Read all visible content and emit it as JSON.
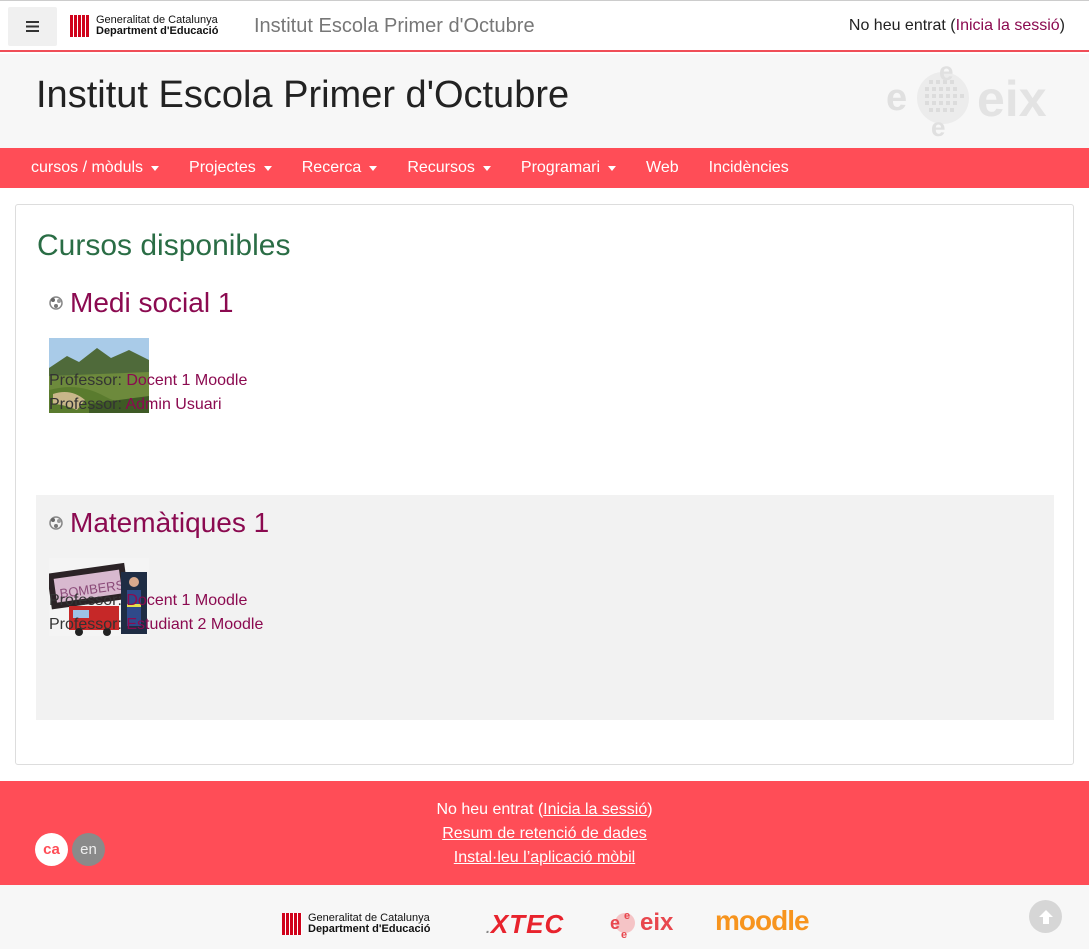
{
  "topbar": {
    "menu_toggle_icon": "hamburger-icon",
    "gencat_line1": "Generalitat de Catalunya",
    "gencat_line2": "Department d'Educació",
    "site_name": "Institut Escola Primer d'Octubre",
    "login_prefix": "No heu entrat (",
    "login_link": "Inicia la sessió",
    "login_suffix": ")"
  },
  "header": {
    "title": "Institut Escola Primer d'Octubre",
    "logo_text": "eix"
  },
  "menu": {
    "items": [
      {
        "label": "cursos / mòduls",
        "dropdown": true
      },
      {
        "label": "Projectes",
        "dropdown": true
      },
      {
        "label": "Recerca",
        "dropdown": true
      },
      {
        "label": "Recursos",
        "dropdown": true
      },
      {
        "label": "Programari",
        "dropdown": true
      },
      {
        "label": "Web",
        "dropdown": false
      },
      {
        "label": "Incidències",
        "dropdown": false
      }
    ]
  },
  "main": {
    "heading": "Cursos disponibles",
    "courses": [
      {
        "title": "Medi social 1",
        "teachers": [
          {
            "role": "Professor:",
            "name": "Docent 1 Moodle"
          },
          {
            "role": "Professor:",
            "name": "Admin Usuari"
          }
        ]
      },
      {
        "title": "Matemàtiques 1",
        "image_text": "BOMBERS",
        "teachers": [
          {
            "role": "Professor:",
            "name": "Docent 1 Moodle"
          },
          {
            "role": "Professor:",
            "name": "Estudiant 2 Moodle"
          }
        ]
      }
    ]
  },
  "footer": {
    "login_prefix": "No heu entrat (",
    "login_link": "Inicia la sessió",
    "login_suffix": ")",
    "data_retention": "Resum de retenció de dades",
    "mobile_app": "Instal·leu l’aplicació mòbil",
    "languages": [
      "ca",
      "en"
    ],
    "selected_language": "ca"
  },
  "bottom_logos": {
    "gencat_line1": "Generalitat de Catalunya",
    "gencat_line2": "Department d'Educació",
    "xtec": "XTEC",
    "eix": "eix",
    "moodle": "moodle"
  },
  "colors": {
    "accent": "#ff4d57",
    "link": "#8b0a50",
    "heading": "#2a6d45"
  }
}
